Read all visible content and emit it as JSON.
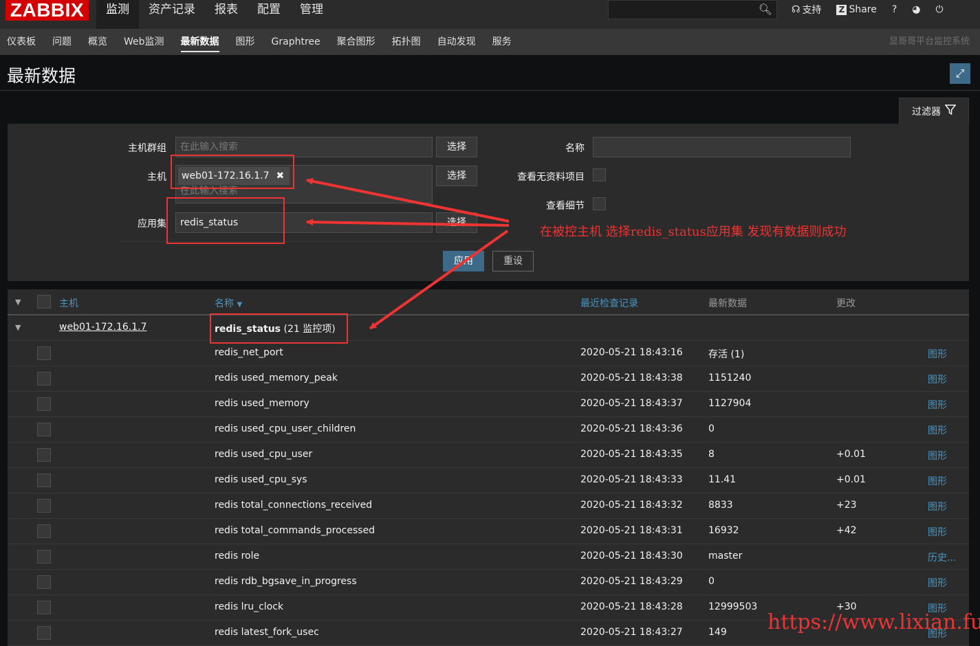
{
  "header": {
    "logo": "ZABBIX",
    "nav": [
      "监测",
      "资产记录",
      "报表",
      "配置",
      "管理"
    ],
    "active_nav": "监测",
    "support": "支持",
    "share": "Share",
    "share_logo": "Z",
    "help": "?"
  },
  "subnav": {
    "items": [
      "仪表板",
      "问题",
      "概览",
      "Web监测",
      "最新数据",
      "图形",
      "Graphtree",
      "聚合图形",
      "拓扑图",
      "自动发现",
      "服务"
    ],
    "active": "最新数据",
    "system_name": "显哥哥平台监控系统"
  },
  "page": {
    "title": "最新数据"
  },
  "filter": {
    "tab_label": "过滤器",
    "host_group_label": "主机群组",
    "host_group_placeholder": "在此输入搜索",
    "host_label": "主机",
    "host_tag": "web01-172.16.1.7",
    "host_placeholder": "在此输入搜索",
    "application_label": "应用集",
    "application_value": "redis_status",
    "select_button": "选择",
    "name_label": "名称",
    "name_value": "",
    "show_without_data_label": "查看无资料项目",
    "show_details_label": "查看细节",
    "apply_button": "应用",
    "reset_button": "重设"
  },
  "annotation": {
    "text": "在被控主机 选择redis_status应用集   发现有数据则成功",
    "watermark": "https://www.lixian.fun",
    "color": "#ee3333"
  },
  "table": {
    "columns": {
      "host": "主机",
      "name": "名称",
      "name_sort": "▼",
      "last_check": "最近检查记录",
      "last_value": "最新数据",
      "change": "更改"
    },
    "group": {
      "host": "web01-172.16.1.7",
      "app": "redis_status",
      "count": "(21 监控项)"
    },
    "rows": [
      {
        "name": "redis_net_port",
        "time": "2020-05-21 18:43:16",
        "value": "存活 (1)",
        "change": "",
        "link": "图形"
      },
      {
        "name": "redis used_memory_peak",
        "time": "2020-05-21 18:43:38",
        "value": "1151240",
        "change": "",
        "link": "图形"
      },
      {
        "name": "redis used_memory",
        "time": "2020-05-21 18:43:37",
        "value": "1127904",
        "change": "",
        "link": "图形"
      },
      {
        "name": "redis used_cpu_user_children",
        "time": "2020-05-21 18:43:36",
        "value": "0",
        "change": "",
        "link": "图形"
      },
      {
        "name": "redis used_cpu_user",
        "time": "2020-05-21 18:43:35",
        "value": "8",
        "change": "+0.01",
        "link": "图形"
      },
      {
        "name": "redis used_cpu_sys",
        "time": "2020-05-21 18:43:33",
        "value": "11.41",
        "change": "+0.01",
        "link": "图形"
      },
      {
        "name": "redis total_connections_received",
        "time": "2020-05-21 18:43:32",
        "value": "8833",
        "change": "+23",
        "link": "图形"
      },
      {
        "name": "redis total_commands_processed",
        "time": "2020-05-21 18:43:31",
        "value": "16932",
        "change": "+42",
        "link": "图形"
      },
      {
        "name": "redis role",
        "time": "2020-05-21 18:43:30",
        "value": "master",
        "change": "",
        "link": "历史..."
      },
      {
        "name": "redis rdb_bgsave_in_progress",
        "time": "2020-05-21 18:43:29",
        "value": "0",
        "change": "",
        "link": "图形"
      },
      {
        "name": "redis lru_clock",
        "time": "2020-05-21 18:43:28",
        "value": "12999503",
        "change": "+30",
        "link": "图形"
      },
      {
        "name": "redis latest_fork_usec",
        "time": "2020-05-21 18:43:27",
        "value": "149",
        "change": "",
        "link": "图形"
      }
    ]
  }
}
